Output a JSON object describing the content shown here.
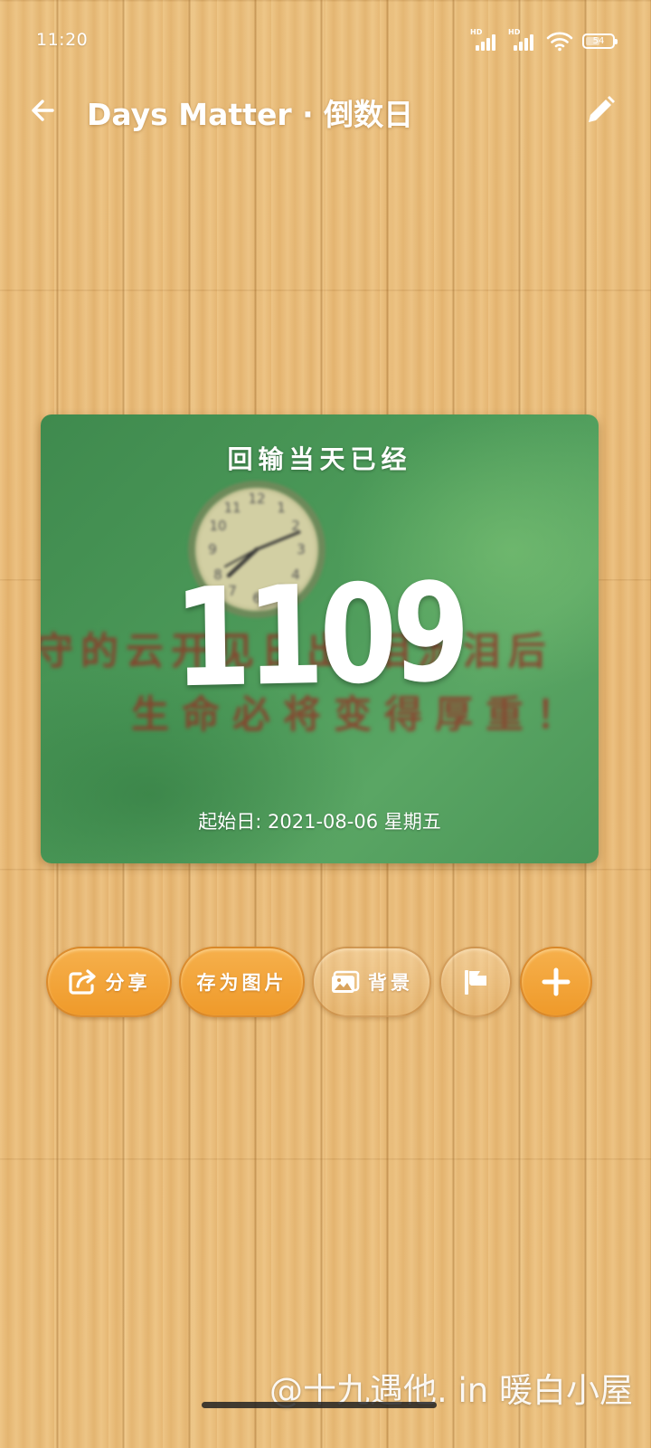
{
  "status_bar": {
    "time": "11:20",
    "signal_1_label": "HD",
    "signal_2_label": "HD",
    "battery_level": "54",
    "battery_fraction": 0.54
  },
  "app_bar": {
    "title": "Days Matter · 倒数日",
    "back_icon": "arrow-left-icon",
    "edit_icon": "pencil-icon"
  },
  "card": {
    "heading": "回输当天已经",
    "day_count": "1109",
    "start_date": "起始日: 2021-08-06 星期五",
    "background_text_line1": "守的云开见日出 泪流泪后",
    "background_text_line2": "生命必将变得厚重！"
  },
  "actions": {
    "share_label": "分享",
    "save_image_label": "存为图片",
    "background_label": "背景",
    "flag_icon": "flag-icon",
    "add_icon": "plus-icon",
    "share_icon": "share-icon",
    "background_icon": "image-icon"
  },
  "watermark": {
    "text": "@十九遇他. in 暖白小屋"
  },
  "colors": {
    "accent_orange": "#f3a63c",
    "card_green": "#4c9a59",
    "text": "#ffffff"
  }
}
